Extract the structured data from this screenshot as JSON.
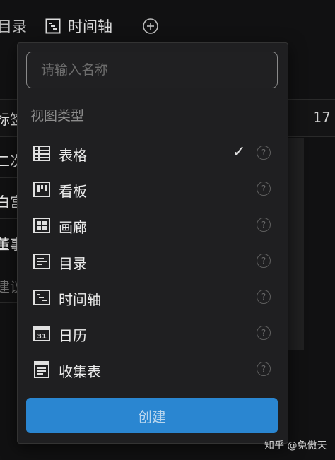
{
  "background": {
    "partial_tab_label": "目录",
    "active_tab_label": "时间轴",
    "column_header_partial": "标签",
    "column_header_right": "17",
    "row_labels_partial": [
      "二次",
      "白宫",
      "董事",
      "建议"
    ]
  },
  "popup": {
    "name_placeholder": "请输入名称",
    "name_value": "",
    "section_label": "视图类型",
    "view_types": [
      {
        "label": "表格",
        "icon": "table-icon",
        "selected": true,
        "check": "✓",
        "help": "?"
      },
      {
        "label": "看板",
        "icon": "kanban-icon",
        "selected": false,
        "help": "?"
      },
      {
        "label": "画廊",
        "icon": "gallery-icon",
        "selected": false,
        "help": "?"
      },
      {
        "label": "目录",
        "icon": "catalog-icon",
        "selected": false,
        "help": "?"
      },
      {
        "label": "时间轴",
        "icon": "timeline-icon",
        "selected": false,
        "help": "?"
      },
      {
        "label": "日历",
        "icon": "calendar-icon",
        "selected": false,
        "help": "?",
        "icon_text": "31"
      },
      {
        "label": "收集表",
        "icon": "form-icon",
        "selected": false,
        "help": "?"
      }
    ],
    "create_label": "创建"
  },
  "watermark": "知乎 @兔傲天",
  "colors": {
    "accent": "#2a86d1",
    "popup_bg": "#1f1f21",
    "page_bg": "#0f0f10"
  }
}
